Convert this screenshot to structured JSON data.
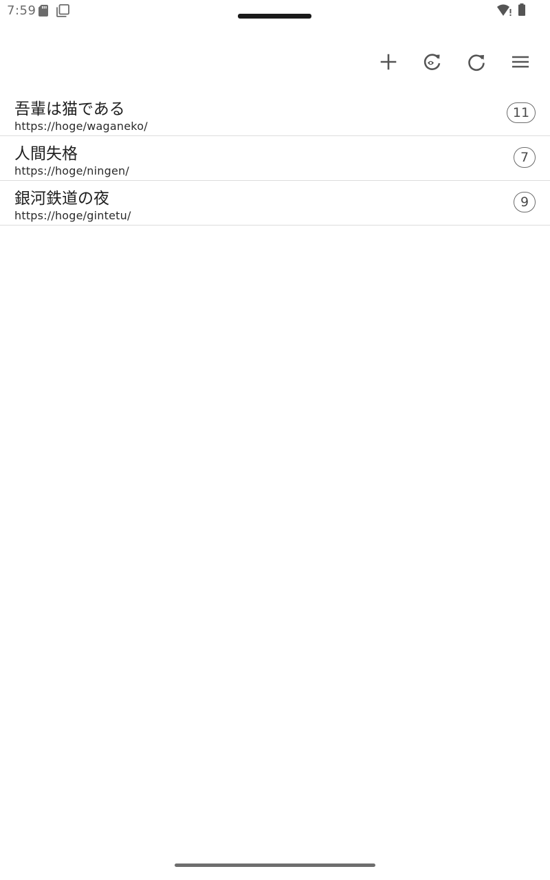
{
  "status_bar": {
    "time": "7:59",
    "icons": [
      "sd-card-icon",
      "copy-icon",
      "wifi-alert-icon",
      "battery-icon"
    ]
  },
  "toolbar": {
    "actions": [
      {
        "name": "add",
        "icon": "plus-icon"
      },
      {
        "name": "sync",
        "icon": "sync-eye-icon"
      },
      {
        "name": "refresh",
        "icon": "refresh-icon"
      },
      {
        "name": "menu",
        "icon": "hamburger-menu-icon"
      }
    ],
    "icon_color": "#555555"
  },
  "books": [
    {
      "title": "吾輩は猫である",
      "url": "https://hoge/waganeko/",
      "count": "11"
    },
    {
      "title": "人間失格",
      "url": "https://hoge/ningen/",
      "count": "7"
    },
    {
      "title": "銀河鉄道の夜",
      "url": "https://hoge/gintetu/",
      "count": "9"
    }
  ]
}
